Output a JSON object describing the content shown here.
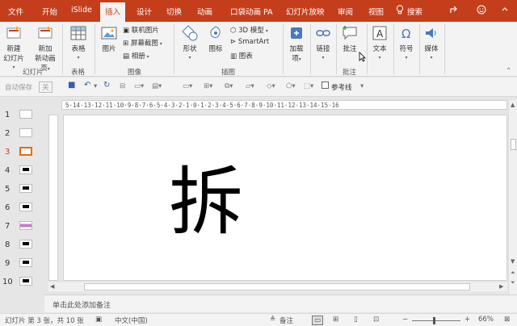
{
  "tabs": [
    "文件",
    "开始",
    "iSlide",
    "插入",
    "设计",
    "切换",
    "动画",
    "口袋动画 PA",
    "幻灯片放映",
    "审阅",
    "视图"
  ],
  "active_tab": "插入",
  "search_label": "搜索",
  "ribbon": {
    "slides": {
      "new_slide": "新建",
      "new_slide2": "幻灯片",
      "new_pres": "新加",
      "new_pres2": "新动画页",
      "group": "幻灯片"
    },
    "table": {
      "label": "表格",
      "group": "表格"
    },
    "images": {
      "picture": "图片",
      "online": "联机图片",
      "screenshot": "屏幕截图",
      "album": "相册",
      "group": "图像"
    },
    "illustrations": {
      "shapes": "形状",
      "icons": "图标",
      "model3d": "3D 模型",
      "smartart": "SmartArt",
      "chart": "图表",
      "group": "插图"
    },
    "addins": {
      "label": "加载",
      "label2": "项",
      "group": ""
    },
    "links": {
      "label": "链接",
      "group": ""
    },
    "comments": {
      "label": "批注",
      "group": "批注"
    },
    "text": {
      "label": "文本"
    },
    "symbols": {
      "label": "符号"
    },
    "media": {
      "label": "媒体"
    }
  },
  "qat": {
    "autosave": "自动保存",
    "autosave_state": "关",
    "guide": "参考线"
  },
  "thumbnails": [
    {
      "num": "1",
      "dark": false
    },
    {
      "num": "2",
      "dark": false
    },
    {
      "num": "3",
      "dark": false,
      "active": true
    },
    {
      "num": "4",
      "dark": true
    },
    {
      "num": "5",
      "dark": true
    },
    {
      "num": "6",
      "dark": true
    },
    {
      "num": "7",
      "dark": false
    },
    {
      "num": "8",
      "dark": true
    },
    {
      "num": "9",
      "dark": true
    },
    {
      "num": "10",
      "dark": true
    }
  ],
  "ruler_text": "5·14·13·12·11·10·9·8·7·6·5·4·3·2·1·0·1·2·3·4·5·6·7·8·9·10·11·12·13·14·15·16",
  "slide_char": "拆",
  "notes_placeholder": "单击此处添加备注",
  "status": {
    "slide_info": "幻灯片 第 3 张，共 10 张",
    "language": "中文(中国)",
    "notes": "备注",
    "zoom": "66%"
  },
  "colors": {
    "accent": "#c43e1c",
    "active_thumb": "#e46c0a"
  }
}
